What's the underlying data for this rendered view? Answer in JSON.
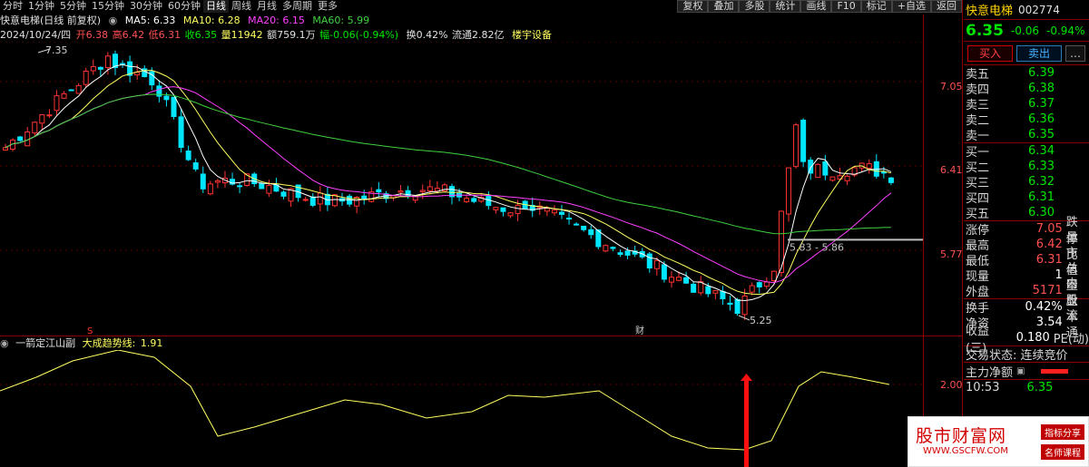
{
  "toolbar": {
    "periods": [
      "分时",
      "1分钟",
      "5分钟",
      "15分钟",
      "30分钟",
      "60分钟",
      "日线",
      "周线",
      "月线",
      "多周期",
      "更多"
    ],
    "active_period": "日线",
    "tools": [
      "复权",
      "叠加",
      "多股",
      "统计",
      "画线",
      "F10",
      "标记",
      "+自选",
      "返回"
    ]
  },
  "info": {
    "stock_name": "快意电梯(日线 前复权)",
    "ma5": "MA5: 6.33",
    "ma10": "MA10: 6.28",
    "ma20": "MA20: 6.15",
    "ma60": "MA60: 5.99",
    "date": "2024/10/24/四",
    "open": "开6.38",
    "high": "高6.42",
    "low": "低6.31",
    "close": "收6.35",
    "volume": "量11942",
    "amount": "额759.1万",
    "change": "幅-0.06(-0.94%)",
    "turnover": "换0.42%",
    "float_cap": "流通2.82亿",
    "sector": "楼宇设备"
  },
  "axis": {
    "main_ticks": [
      "7.05",
      "6.41",
      "5.77"
    ],
    "sub_ticks": [
      "2.00"
    ]
  },
  "annotations": {
    "high_label": "7.35",
    "low_label": "5.25",
    "line_label": "5.83 - 5.86",
    "marker_s": "S",
    "marker_cai": "财"
  },
  "indicator": {
    "name": "一箭定江山副",
    "line_name": "大成趋势线:",
    "line_value": "1.91"
  },
  "panel": {
    "name": "快意电梯",
    "code": "002774",
    "price": "6.35",
    "change": "-0.06",
    "pct": "-0.94%",
    "buy_btn": "买入",
    "sell_btn": "卖出",
    "more_btn": "…",
    "asks": [
      {
        "label": "卖五",
        "price": "6.39"
      },
      {
        "label": "卖四",
        "price": "6.38"
      },
      {
        "label": "卖三",
        "price": "6.37"
      },
      {
        "label": "卖二",
        "price": "6.36"
      },
      {
        "label": "卖一",
        "price": "6.35"
      }
    ],
    "bids": [
      {
        "label": "买一",
        "price": "6.34"
      },
      {
        "label": "买二",
        "price": "6.33"
      },
      {
        "label": "买三",
        "price": "6.32"
      },
      {
        "label": "买四",
        "price": "6.31"
      },
      {
        "label": "买五",
        "price": "6.30"
      }
    ],
    "stats": [
      {
        "label": "涨停",
        "value": "7.05",
        "label2": "跌停"
      },
      {
        "label": "最高",
        "value": "6.42",
        "label2": "量比"
      },
      {
        "label": "最低",
        "value": "6.31",
        "label2": "市值"
      },
      {
        "label": "现量",
        "value": "1",
        "label2": "总量"
      },
      {
        "label": "外盘",
        "value": "5171",
        "label2": "内盘"
      }
    ],
    "stats2": [
      {
        "label": "换手",
        "value": "0.42%",
        "label2": "股本"
      },
      {
        "label": "净资",
        "value": "3.54",
        "label2": "流通"
      },
      {
        "label": "收益(三)",
        "value": "0.180",
        "label2": "PE(动)"
      }
    ],
    "trade_status": "交易状态: 连续竞价",
    "main_flow": "主力净额",
    "time_partial": "10:53",
    "price_partial": "6.35"
  },
  "watermark": {
    "site": "股市财富网",
    "url": "WWW.GSCFW.COM",
    "tag1": "指标分享",
    "tag2": "名师课程"
  },
  "colors": {
    "up": "#ff3232",
    "down": "#00e6ff",
    "ma5": "#ffffff",
    "ma10": "#ffff60",
    "ma20": "#ff40ff",
    "ma60": "#40d040"
  }
}
